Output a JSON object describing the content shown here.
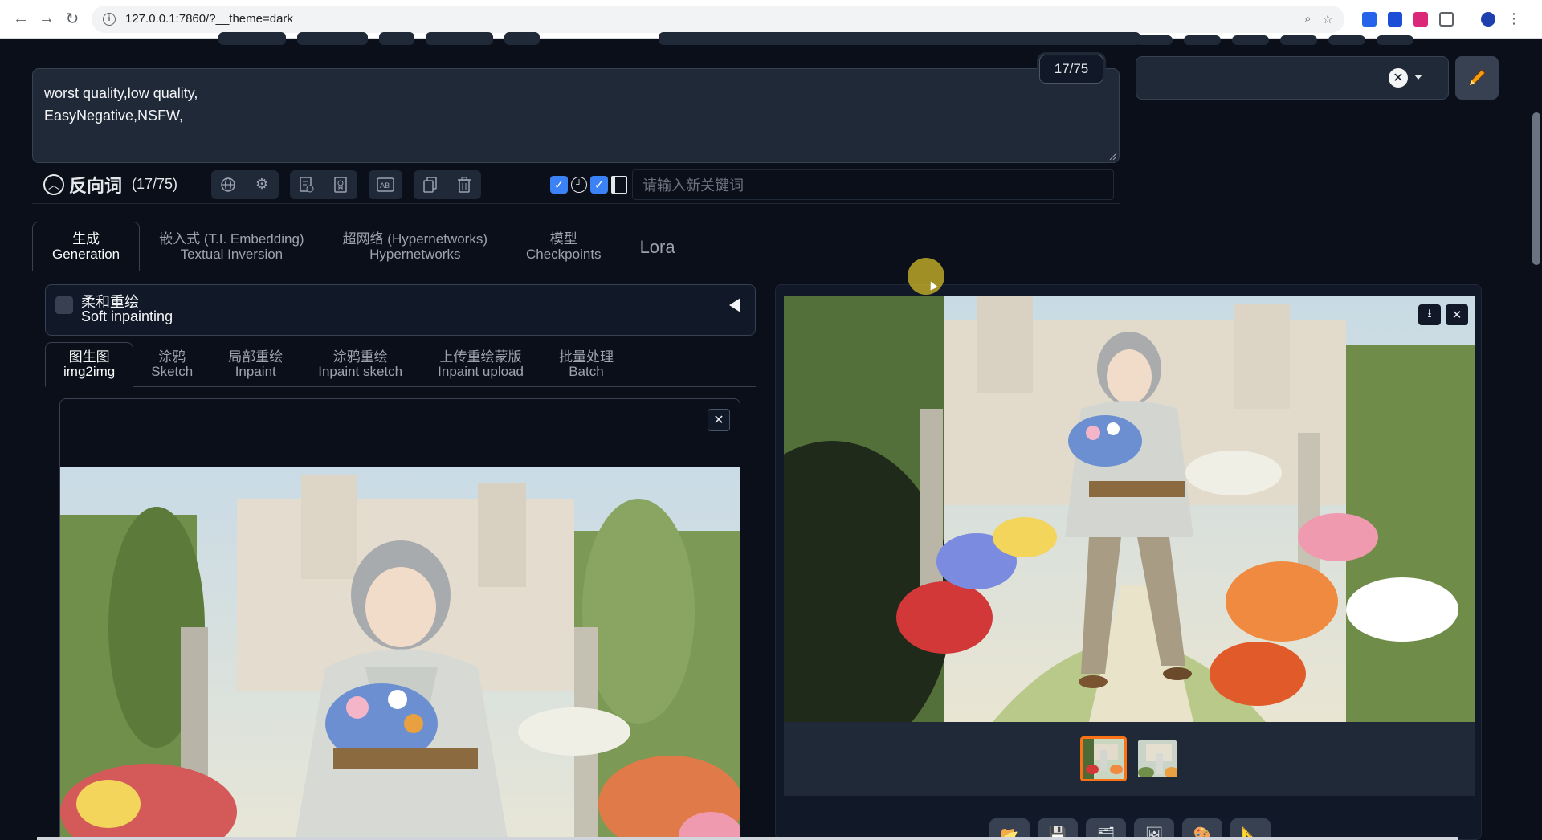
{
  "browser": {
    "url": "127.0.0.1:7860/?__theme=dark"
  },
  "negative_prompt": {
    "text_line1": "worst quality,low quality,",
    "text_line2": "EasyNegative,NSFW,",
    "token_count": "17/75",
    "title": "反向词",
    "count": "(17/75)",
    "keyword_placeholder": "请输入新关键词"
  },
  "main_tabs": [
    {
      "cn": "生成",
      "en": "Generation"
    },
    {
      "cn": "嵌入式 (T.I. Embedding)",
      "en": "Textual Inversion"
    },
    {
      "cn": "超网络 (Hypernetworks)",
      "en": "Hypernetworks"
    },
    {
      "cn": "模型",
      "en": "Checkpoints"
    },
    {
      "single": "Lora"
    }
  ],
  "soft_inpainting": {
    "cn": "柔和重绘",
    "en": "Soft inpainting"
  },
  "sub_tabs": [
    {
      "cn": "图生图",
      "en": "img2img"
    },
    {
      "cn": "涂鸦",
      "en": "Sketch"
    },
    {
      "cn": "局部重绘",
      "en": "Inpaint"
    },
    {
      "cn": "涂鸦重绘",
      "en": "Inpaint sketch"
    },
    {
      "cn": "上传重绘蒙版",
      "en": "Inpaint upload"
    },
    {
      "cn": "批量处理",
      "en": "Batch"
    }
  ],
  "colors": {
    "background": "#0b0f19",
    "panel": "#1f2937",
    "accent": "#f97316",
    "checkbox": "#3b82f6"
  }
}
